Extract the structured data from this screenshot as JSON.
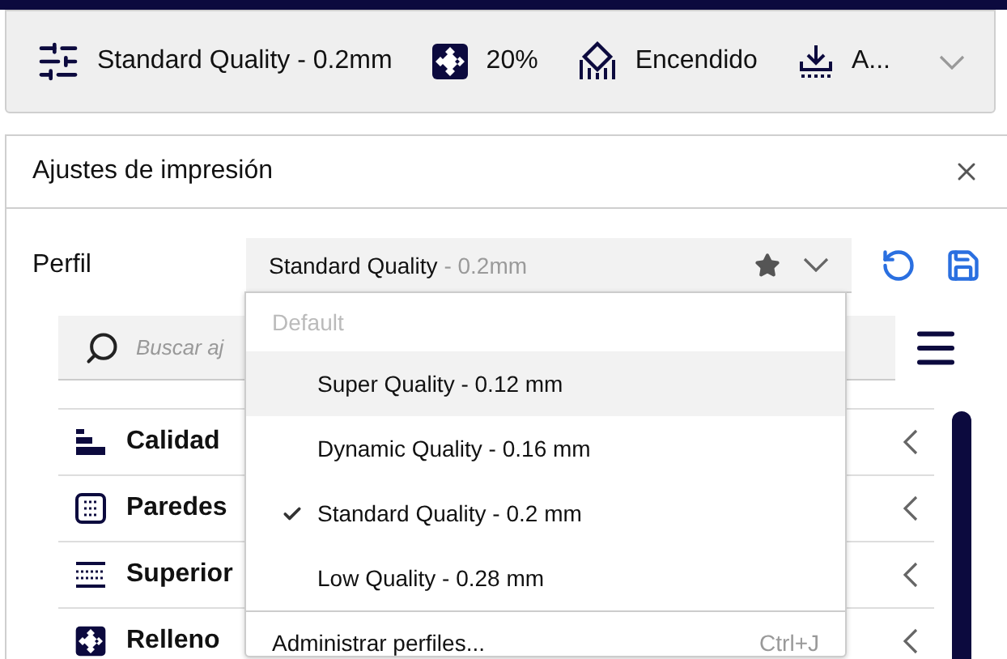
{
  "top_bar": {
    "profile": "Standard Quality - 0.2mm",
    "infill": "20%",
    "support": "Encendido",
    "adhesion": "A..."
  },
  "dialog": {
    "title": "Ajustes de impresión",
    "profile_label": "Perfil",
    "profile_select": {
      "name": "Standard Quality",
      "suffix": "- 0.2mm"
    }
  },
  "search": {
    "placeholder": "Buscar aj"
  },
  "categories": [
    {
      "label": "Calidad",
      "kind": "quality"
    },
    {
      "label": "Paredes",
      "kind": "walls"
    },
    {
      "label": "Superior",
      "kind": "topbottom"
    },
    {
      "label": "Relleno",
      "kind": "infill"
    }
  ],
  "profile_menu": {
    "section": "Default",
    "items": [
      {
        "label": "Super Quality - 0.12 mm",
        "selected": false,
        "hovered": true
      },
      {
        "label": "Dynamic Quality - 0.16 mm",
        "selected": false,
        "hovered": false
      },
      {
        "label": "Standard Quality - 0.2 mm",
        "selected": true,
        "hovered": false
      },
      {
        "label": "Low Quality - 0.28 mm",
        "selected": false,
        "hovered": false
      }
    ],
    "manage": {
      "label": "Administrar perfiles...",
      "shortcut": "Ctrl+J"
    }
  }
}
